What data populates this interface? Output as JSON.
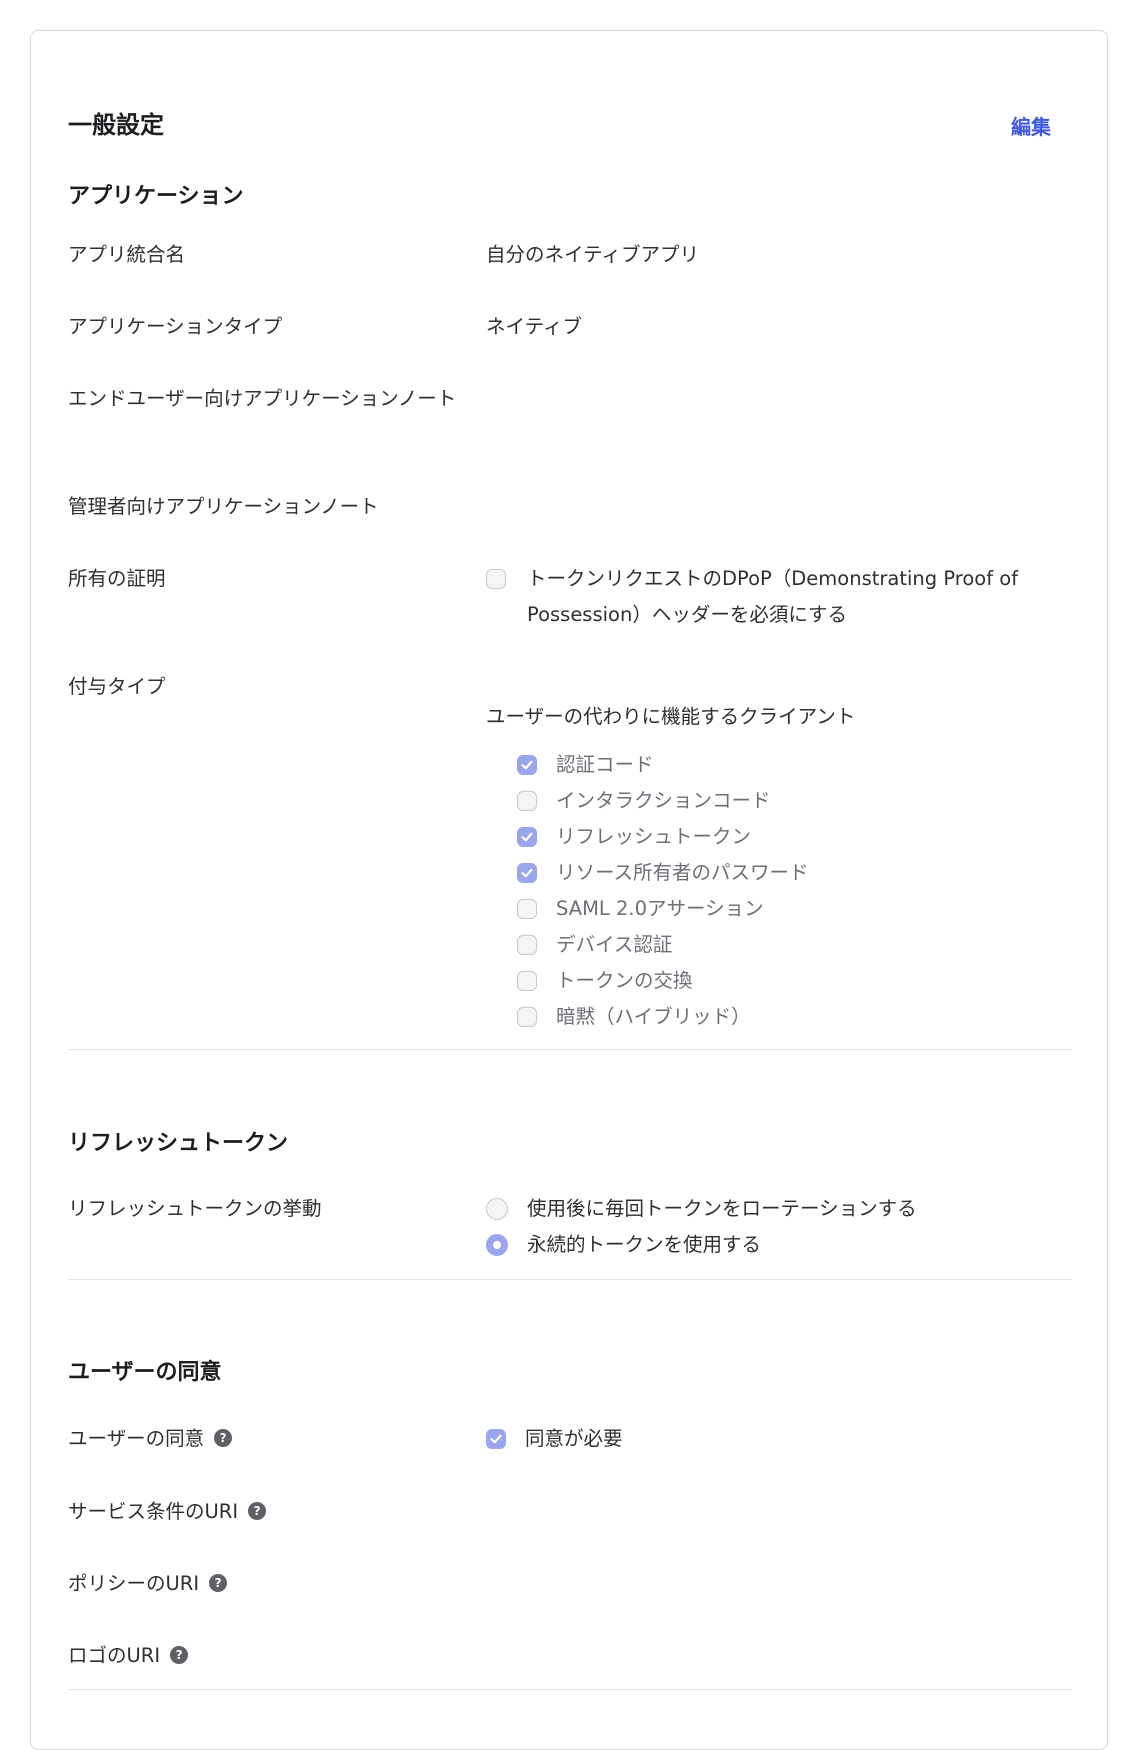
{
  "card": {
    "title": "一般設定",
    "edit_label": "編集"
  },
  "application": {
    "section_title": "アプリケーション",
    "rows": {
      "app_name": {
        "label": "アプリ統合名",
        "value": "自分のネイティブアプリ"
      },
      "app_type": {
        "label": "アプリケーションタイプ",
        "value": "ネイティブ"
      },
      "end_user_note": {
        "label": "エンドユーザー向けアプリケーションノート"
      },
      "admin_note": {
        "label": "管理者向けアプリケーションノート"
      },
      "proof": {
        "label": "所有の証明",
        "checkbox_label": "トークンリクエストのDPoP（Demonstrating Proof of Possession）ヘッダーを必須にする",
        "checked": false
      },
      "grant": {
        "label": "付与タイプ",
        "group_title": "ユーザーの代わりに機能するクライアント",
        "options": [
          {
            "label": "認証コード",
            "checked": true
          },
          {
            "label": "インタラクションコード",
            "checked": false
          },
          {
            "label": "リフレッシュトークン",
            "checked": true
          },
          {
            "label": "リソース所有者のパスワード",
            "checked": true
          },
          {
            "label": "SAML 2.0アサーション",
            "checked": false
          },
          {
            "label": "デバイス認証",
            "checked": false
          },
          {
            "label": "トークンの交換",
            "checked": false
          },
          {
            "label": "暗黙（ハイブリッド）",
            "checked": false
          }
        ]
      }
    }
  },
  "refresh": {
    "section_title": "リフレッシュトークン",
    "behavior_label": "リフレッシュトークンの挙動",
    "options": [
      {
        "label": "使用後に毎回トークンをローテーションする",
        "selected": false
      },
      {
        "label": "永続的トークンを使用する",
        "selected": true
      }
    ]
  },
  "consent": {
    "section_title": "ユーザーの同意",
    "user_consent_label": "ユーザーの同意",
    "consent_required_label": "同意が必要",
    "consent_required": true,
    "tos_label": "サービス条件のURI",
    "policy_label": "ポリシーのURI",
    "logo_label": "ロゴのURI",
    "help_glyph": "?"
  }
}
